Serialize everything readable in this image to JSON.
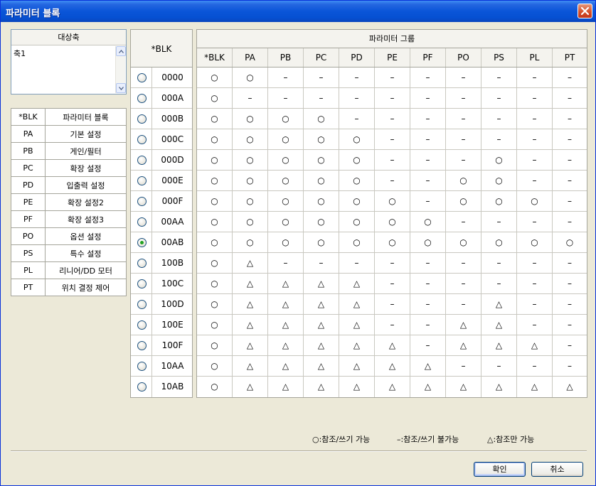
{
  "window": {
    "title": "파라미터 블록"
  },
  "axis": {
    "header": "대상축",
    "items": [
      "축1"
    ]
  },
  "legend": [
    {
      "code": "*BLK",
      "name": "파라미터 블록"
    },
    {
      "code": "PA",
      "name": "기본 설정"
    },
    {
      "code": "PB",
      "name": "게인/필터"
    },
    {
      "code": "PC",
      "name": "확장 설정"
    },
    {
      "code": "PD",
      "name": "입출력 설정"
    },
    {
      "code": "PE",
      "name": "확장 설정2"
    },
    {
      "code": "PF",
      "name": "확장 설정3"
    },
    {
      "code": "PO",
      "name": "옵션 설정"
    },
    {
      "code": "PS",
      "name": "특수 설정"
    },
    {
      "code": "PL",
      "name": "리니어/DD 모터"
    },
    {
      "code": "PT",
      "name": "위치 결정 제어"
    }
  ],
  "blk": {
    "header": "*BLK",
    "selected": "00AB",
    "rows": [
      "0000",
      "000A",
      "000B",
      "000C",
      "000D",
      "000E",
      "000F",
      "00AA",
      "00AB",
      "100B",
      "100C",
      "100D",
      "100E",
      "100F",
      "10AA",
      "10AB"
    ]
  },
  "group": {
    "title": "파라미터 그룹",
    "columns": [
      "*BLK",
      "PA",
      "PB",
      "PC",
      "PD",
      "PE",
      "PF",
      "PO",
      "PS",
      "PL",
      "PT"
    ],
    "rows": [
      [
        "○",
        "○",
        "–",
        "–",
        "–",
        "–",
        "–",
        "–",
        "–",
        "–",
        "–"
      ],
      [
        "○",
        "–",
        "–",
        "–",
        "–",
        "–",
        "–",
        "–",
        "–",
        "–",
        "–"
      ],
      [
        "○",
        "○",
        "○",
        "○",
        "–",
        "–",
        "–",
        "–",
        "–",
        "–",
        "–"
      ],
      [
        "○",
        "○",
        "○",
        "○",
        "○",
        "–",
        "–",
        "–",
        "–",
        "–",
        "–"
      ],
      [
        "○",
        "○",
        "○",
        "○",
        "○",
        "–",
        "–",
        "–",
        "○",
        "–",
        "–"
      ],
      [
        "○",
        "○",
        "○",
        "○",
        "○",
        "–",
        "–",
        "○",
        "○",
        "–",
        "–"
      ],
      [
        "○",
        "○",
        "○",
        "○",
        "○",
        "○",
        "–",
        "○",
        "○",
        "○",
        "–"
      ],
      [
        "○",
        "○",
        "○",
        "○",
        "○",
        "○",
        "○",
        "–",
        "–",
        "–",
        "–"
      ],
      [
        "○",
        "○",
        "○",
        "○",
        "○",
        "○",
        "○",
        "○",
        "○",
        "○",
        "○"
      ],
      [
        "○",
        "△",
        "–",
        "–",
        "–",
        "–",
        "–",
        "–",
        "–",
        "–",
        "–"
      ],
      [
        "○",
        "△",
        "△",
        "△",
        "△",
        "–",
        "–",
        "–",
        "–",
        "–",
        "–"
      ],
      [
        "○",
        "△",
        "△",
        "△",
        "△",
        "–",
        "–",
        "–",
        "△",
        "–",
        "–"
      ],
      [
        "○",
        "△",
        "△",
        "△",
        "△",
        "–",
        "–",
        "△",
        "△",
        "–",
        "–"
      ],
      [
        "○",
        "△",
        "△",
        "△",
        "△",
        "△",
        "–",
        "△",
        "△",
        "△",
        "–"
      ],
      [
        "○",
        "△",
        "△",
        "△",
        "△",
        "△",
        "△",
        "–",
        "–",
        "–",
        "–"
      ],
      [
        "○",
        "△",
        "△",
        "△",
        "△",
        "△",
        "△",
        "△",
        "△",
        "△",
        "△"
      ]
    ]
  },
  "footer": {
    "legend_rw": "○:참조/쓰기 가능",
    "legend_no": "–:참조/쓰기 불가능",
    "legend_ro": "△:참조만 가능",
    "ok_label": "확인",
    "cancel_label": "취소"
  }
}
